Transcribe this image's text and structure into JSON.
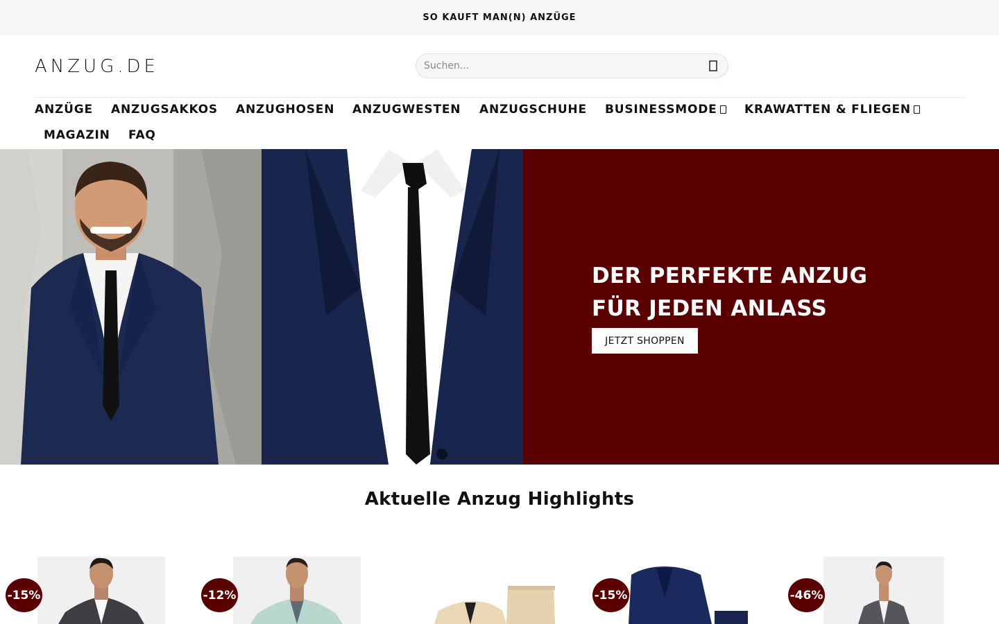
{
  "topbar": {
    "text": "SO KAUFT MAN(N) ANZÜGE"
  },
  "header": {
    "logo": "ANZUG.DE",
    "search": {
      "placeholder": "Suchen...",
      "icon": "search-icon"
    }
  },
  "nav": {
    "items": [
      {
        "label": "ANZÜGE",
        "dropdown": false
      },
      {
        "label": "ANZUGSAKKOS",
        "dropdown": false
      },
      {
        "label": "ANZUGHOSEN",
        "dropdown": false
      },
      {
        "label": "ANZUGWESTEN",
        "dropdown": false
      },
      {
        "label": "ANZUGSCHUHE",
        "dropdown": false
      },
      {
        "label": "BUSINESSMODE",
        "dropdown": true
      },
      {
        "label": "KRAWATTEN & FLIEGEN",
        "dropdown": true
      },
      {
        "label": "MAGAZIN",
        "dropdown": false
      },
      {
        "label": "FAQ",
        "dropdown": false
      }
    ]
  },
  "hero": {
    "headline_line1": "DER PERFEKTE ANZUG",
    "headline_line2": "FÜR JEDEN ANLASS",
    "cta": "JETZT SHOPPEN",
    "background_color": "#5b0000"
  },
  "highlights": {
    "title": "Aktuelle Anzug Highlights",
    "products": [
      {
        "badge": "-15%",
        "image": "man-in-grey-suit"
      },
      {
        "badge": "-12%",
        "image": "man-in-mint-blazer"
      },
      {
        "badge": "",
        "image": "beige-suit-flatlay"
      },
      {
        "badge": "-15%",
        "image": "navy-suit-flatlay"
      },
      {
        "badge": "-46%",
        "image": "man-in-grey-suit-white-shirt"
      }
    ]
  },
  "colors": {
    "accent": "#5b0000",
    "topbar_bg": "#f7f7f7",
    "text": "#111111"
  }
}
